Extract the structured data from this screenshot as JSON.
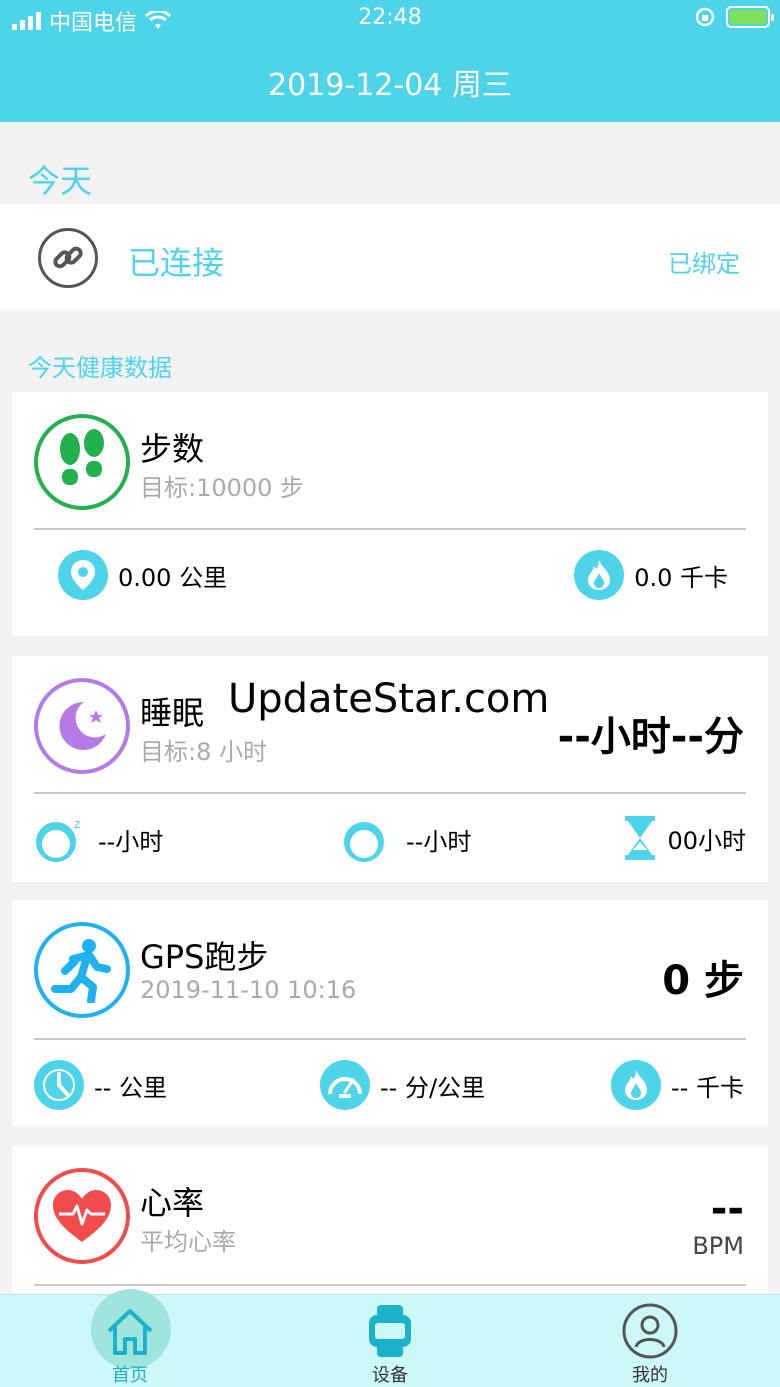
{
  "status_bar": {
    "carrier": "中国电信",
    "time": "22:48"
  },
  "header": {
    "title": "2019-12-04 周三"
  },
  "today": {
    "label": "今天"
  },
  "connection": {
    "status": "已连接",
    "bound": "已绑定"
  },
  "health": {
    "label": "今天健康数据"
  },
  "steps_card": {
    "title": "步数",
    "goal": "目标:10000 步",
    "distance": "0.00 公里",
    "calories": "0.0 千卡"
  },
  "sleep_card": {
    "title": "睡眠",
    "goal": "目标:8 小时",
    "total": "--小时--分",
    "deep": "--小时",
    "light": "--小时",
    "awake": "00小时"
  },
  "gps_card": {
    "title": "GPS跑步",
    "datetime": "2019-11-10 10:16",
    "steps": "0 步",
    "distance": "-- 公里",
    "pace": "-- 分/公里",
    "calories": "-- 千卡"
  },
  "heart_card": {
    "title": "心率",
    "subtitle": "平均心率",
    "value": "--",
    "unit": "BPM"
  },
  "watermark": "UpdateStar.com",
  "tabs": [
    {
      "label": "首页"
    },
    {
      "label": "设备"
    },
    {
      "label": "我的"
    }
  ],
  "colors": {
    "accent": "#4dd4e8",
    "steps": "#22b14c",
    "sleep": "#b47be6",
    "gps": "#1fb2ef",
    "heart": "#f24b4b"
  }
}
